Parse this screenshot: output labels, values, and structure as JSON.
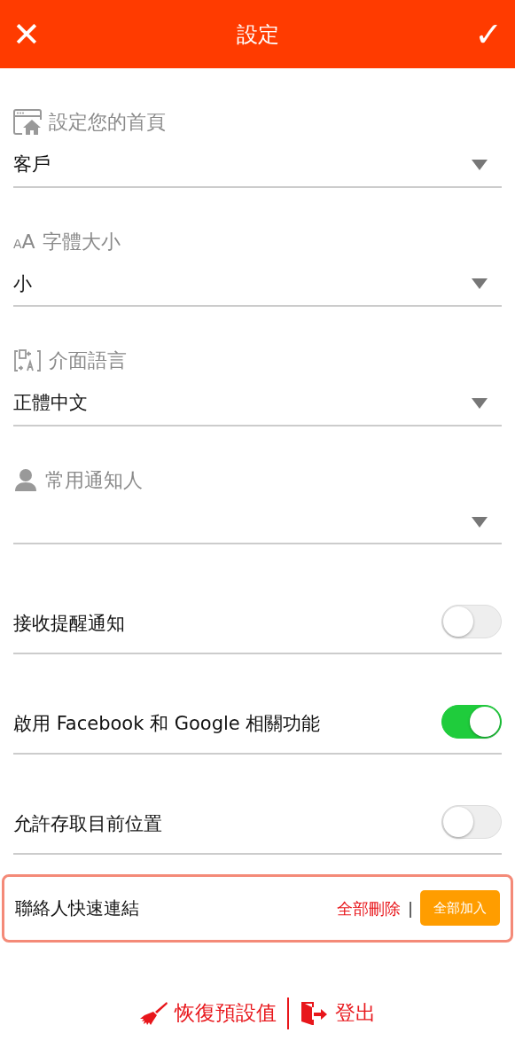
{
  "header": {
    "close": "✕",
    "title": "設定",
    "confirm": "✓"
  },
  "selects": [
    {
      "kind": "home",
      "label": "設定您的首頁",
      "value": "客戶"
    },
    {
      "kind": "font",
      "label": "字體大小",
      "value": "小",
      "glyphs": [
        "A",
        "A"
      ]
    },
    {
      "kind": "language",
      "label": "介面語言",
      "value": "正體中文"
    },
    {
      "kind": "contact",
      "label": "常用通知人"
    }
  ],
  "toggles": [
    {
      "label": "接收提醒通知",
      "on": false
    },
    {
      "label": "啟用 Facebook 和 Google 相關功能",
      "on": true
    },
    {
      "label": "允許存取目前位置",
      "on": false
    }
  ],
  "quick_links": {
    "label": "聯絡人快速連結",
    "delete_all": "全部刪除",
    "separator": "|",
    "add_all": "全部加入"
  },
  "footer": {
    "reset": "恢復預設值",
    "logout": "登出"
  }
}
